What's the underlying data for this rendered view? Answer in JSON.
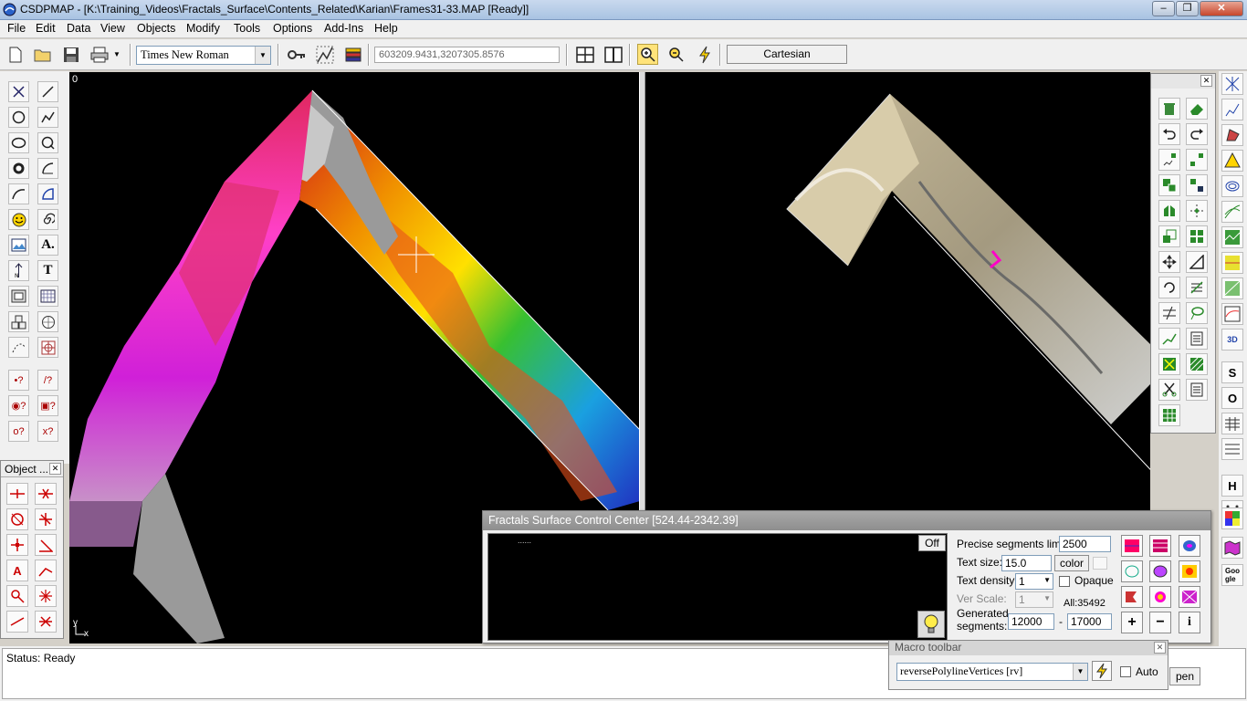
{
  "window": {
    "title": "CSDPMAP - [K:\\Training_Videos\\Fractals_Surface\\Contents_Related\\Karian\\Frames31-33.MAP [Ready]]",
    "minimize": "–",
    "maximize": "❐",
    "close": "✕"
  },
  "menu": [
    "File",
    "Edit",
    "Data",
    "View",
    "Objects",
    "Modify",
    "Tools",
    "Options",
    "Add-Ins",
    "Help"
  ],
  "toolbar": {
    "font": "Times New Roman",
    "coordinates": "603209.9431,3207305.8576",
    "projection": "Cartesian"
  },
  "viewport_left": {
    "corner_label": "0",
    "axis_y": "y",
    "axis_x": "x"
  },
  "object_panel": {
    "title": "Object ...",
    "close": "✕"
  },
  "status": {
    "text": "Status: Ready"
  },
  "fscc": {
    "title": "Fractals Surface Control Center [524.44-2342.39]",
    "dots": "......",
    "off_label": "Off",
    "precise_label": "Precise segments limit:",
    "precise_value": "2500",
    "textsize_label": "Text size:",
    "textsize_value": "15.0",
    "color_label": "color",
    "density_label": "Text density:",
    "density_value": "1",
    "opaque_label": "Opaque",
    "verscale_label": "Ver Scale:",
    "verscale_value": "1",
    "all_label": "All:35492",
    "generated_label_1": "Generated",
    "generated_label_2": "segments:",
    "gen_from": "12000",
    "gen_dash": "-",
    "gen_to": "17000"
  },
  "macro": {
    "title": "Macro toolbar",
    "close": "✕",
    "value": "reversePolylineVertices [rv]",
    "auto_label": "Auto",
    "open_label": "pen"
  },
  "right_column": [
    "S",
    "O",
    "H"
  ],
  "colors": {
    "titlebar": "#b8cde8",
    "canvas": "#000000",
    "panel": "#f0f0f0",
    "magenta_marker": "#ff00c8"
  }
}
